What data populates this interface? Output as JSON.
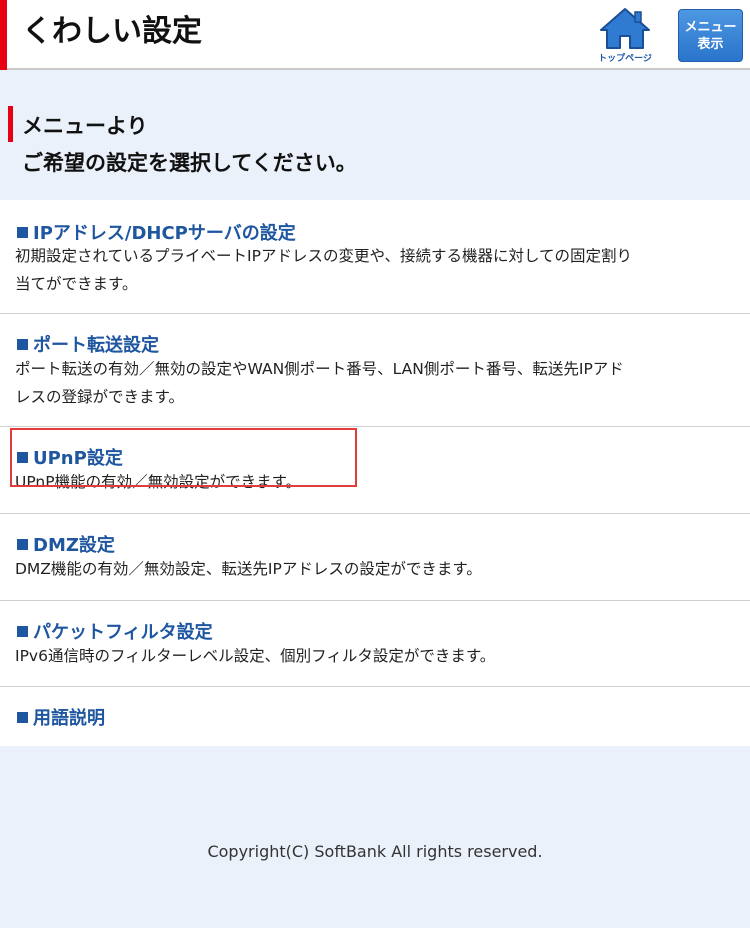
{
  "header": {
    "title": "くわしい設定",
    "top_page_label": "トップページ",
    "menu_button_line1": "メニュー",
    "menu_button_line2": "表示"
  },
  "intro": {
    "line1": "メニューより",
    "line2": "ご希望の設定を選択してください。"
  },
  "menu": {
    "items": [
      {
        "title": "IPアドレス/DHCPサーバの設定",
        "desc_line1": "初期設定されているプライベートIPアドレスの変更や、接続する機器に対しての固定割り",
        "desc_line2": "当てができます。"
      },
      {
        "title": "ポート転送設定",
        "desc_line1": "ポート転送の有効／無効の設定やWAN側ポート番号、LAN側ポート番号、転送先IPアド",
        "desc_line2": "レスの登録ができます。"
      },
      {
        "title": "UPnP設定",
        "desc_line1": "UPnP機能の有効／無効設定ができます。"
      },
      {
        "title": "DMZ設定",
        "desc_line1": "DMZ機能の有効／無効設定、転送先IPアドレスの設定ができます。"
      },
      {
        "title": "パケットフィルタ設定",
        "desc_line1": "IPv6通信時のフィルターレベル設定、個別フィルタ設定ができます。"
      },
      {
        "title": "用語説明"
      }
    ]
  },
  "footer": {
    "copyright": "Copyright(C) SoftBank All rights reserved."
  },
  "colors": {
    "accent_red": "#e60012",
    "link_blue": "#1e56a0",
    "page_bg": "#eaf1fa",
    "highlight_border": "#e23b3b"
  }
}
